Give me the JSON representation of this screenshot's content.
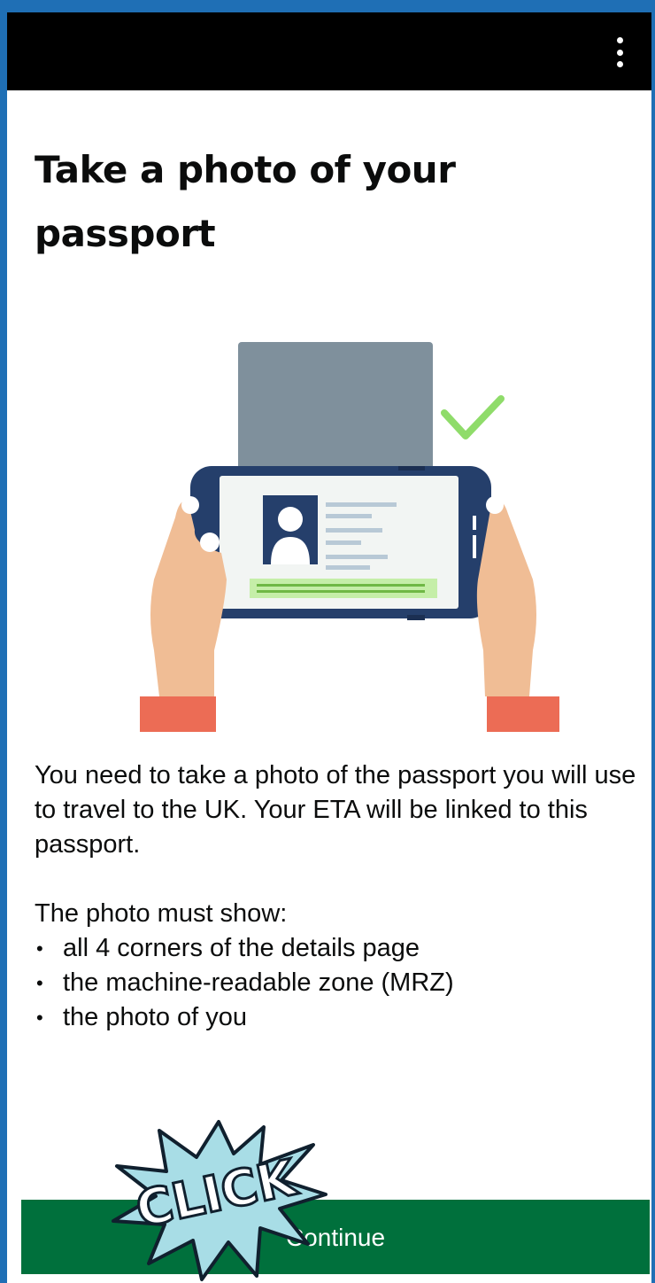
{
  "header": {
    "menu_icon": "more-vertical-icon"
  },
  "page": {
    "title": "Take a photo of your passport",
    "intro": "You need to take a photo of the passport you will use to travel to the UK. Your ETA will be linked to this passport.",
    "requirements_heading": "The photo must show:",
    "requirements": [
      "all 4 corners of the details page",
      "the machine-readable zone (MRZ)",
      "the photo of you"
    ],
    "bullet": "•"
  },
  "illustration": {
    "icon": "passport-scan-illustration",
    "check_icon": "checkmark-icon"
  },
  "actions": {
    "continue_label": "Continue"
  },
  "overlay": {
    "burst_text": "CLICK"
  },
  "colors": {
    "topbar": "#000000",
    "button": "#00703c",
    "frame_border": "#1f6fb5",
    "check": "#8fdc6a"
  }
}
